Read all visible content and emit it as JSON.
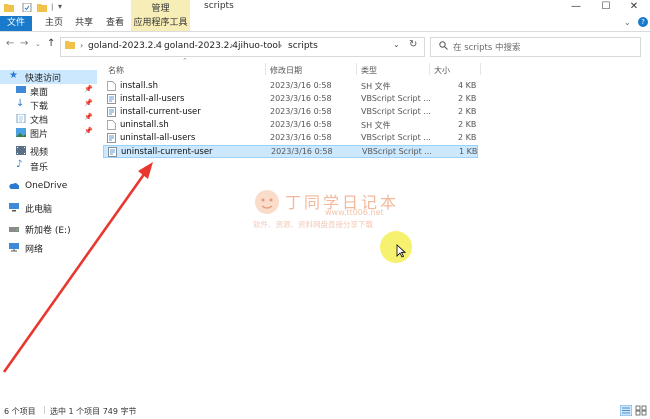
{
  "titlebar": {
    "context_tab": "管理",
    "title": "scripts"
  },
  "ribbon": {
    "tabs": [
      "文件",
      "主页",
      "共享",
      "查看",
      "应用程序工具"
    ]
  },
  "address": {
    "path": [
      "goland-2023.2.4",
      "goland-2023.2.4",
      "jihuo-tool",
      "scripts"
    ],
    "search_placeholder": "在 scripts 中搜索"
  },
  "sidebar": {
    "items": [
      {
        "label": "快速访问",
        "icon": "star-icon"
      },
      {
        "label": "桌面",
        "icon": "desktop-icon"
      },
      {
        "label": "下载",
        "icon": "download-icon"
      },
      {
        "label": "文档",
        "icon": "documents-icon"
      },
      {
        "label": "图片",
        "icon": "pictures-icon"
      },
      {
        "label": "视频",
        "icon": "videos-icon"
      },
      {
        "label": "音乐",
        "icon": "music-icon"
      },
      {
        "label": "OneDrive",
        "icon": "cloud-icon"
      },
      {
        "label": "此电脑",
        "icon": "computer-icon"
      },
      {
        "label": "新加卷 (E:)",
        "icon": "drive-icon"
      },
      {
        "label": "网络",
        "icon": "network-icon"
      }
    ]
  },
  "columns": {
    "name": "名称",
    "date": "修改日期",
    "type": "类型",
    "size": "大小"
  },
  "files": [
    {
      "name": "install.sh",
      "date": "2023/3/16 0:58",
      "type": "SH 文件",
      "size": "4 KB",
      "icon": "file-icon"
    },
    {
      "name": "install-all-users",
      "date": "2023/3/16 0:58",
      "type": "VBScript Script ...",
      "size": "2 KB",
      "icon": "script-icon"
    },
    {
      "name": "install-current-user",
      "date": "2023/3/16 0:58",
      "type": "VBScript Script ...",
      "size": "2 KB",
      "icon": "script-icon"
    },
    {
      "name": "uninstall.sh",
      "date": "2023/3/16 0:58",
      "type": "SH 文件",
      "size": "2 KB",
      "icon": "file-icon"
    },
    {
      "name": "uninstall-all-users",
      "date": "2023/3/16 0:58",
      "type": "VBScript Script ...",
      "size": "2 KB",
      "icon": "script-icon"
    },
    {
      "name": "uninstall-current-user",
      "date": "2023/3/16 0:58",
      "type": "VBScript Script ...",
      "size": "1 KB",
      "icon": "script-icon",
      "selected": true
    }
  ],
  "watermark": {
    "title": "丁同学日记本",
    "url": "www.tt006.net",
    "subtitle": "软件、资源、资料网盘直接分享下载"
  },
  "status": {
    "item_count": "6 个项目",
    "selection": "选中 1 个项目 749 字节"
  },
  "colors": {
    "accent": "#1979ca",
    "selection_bg": "#cce8ff",
    "context_tab": "#f7edb7",
    "arrow": "#e8382e"
  }
}
